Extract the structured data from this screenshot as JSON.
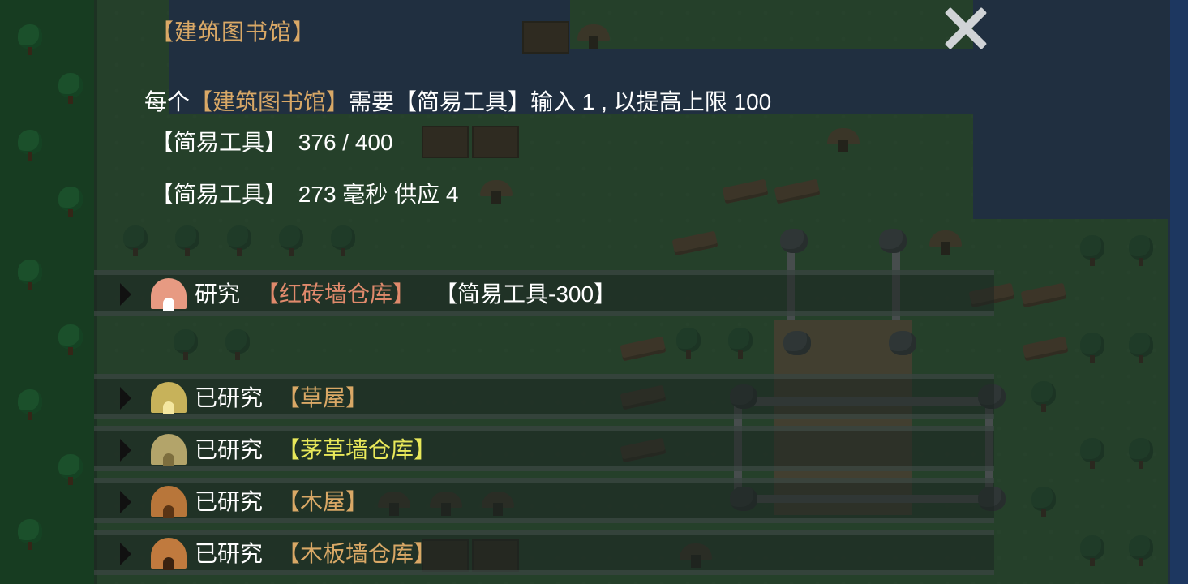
{
  "panel": {
    "title": "【建筑图书馆】",
    "close_label": "close"
  },
  "info": {
    "l1_prefix": "每个",
    "l1_building": "【建筑图书馆】",
    "l1_mid": "需要【简易工具】输入 1 , 以提高上限 100",
    "l2_item": "【简易工具】",
    "l2_value": "376 / 400",
    "l3_item": "【简易工具】",
    "l3_value": "273 毫秒 供应 4"
  },
  "research": [
    {
      "status": "研究",
      "name": "【红砖墙仓库】",
      "cost": "【简易工具-300】",
      "name_color": "#e08a6c",
      "icon": "brick-hut-icon",
      "roof": "#e79a82",
      "door": "#ffffff"
    },
    {
      "status": "已研究",
      "name": "【草屋】",
      "cost": "",
      "name_color": "#d9a866",
      "icon": "straw-hut-icon",
      "roof": "#c7b25a",
      "door": "#f4e7a0"
    },
    {
      "status": "已研究",
      "name": "【茅草墙仓库】",
      "cost": "",
      "name_color": "#e8e85a",
      "icon": "thatch-hut-icon",
      "roof": "#b3a46a",
      "door": "#7d6e3e"
    },
    {
      "status": "已研究",
      "name": "【木屋】",
      "cost": "",
      "name_color": "#d9a866",
      "icon": "wood-hut-icon",
      "roof": "#b8763a",
      "door": "#5a3414"
    },
    {
      "status": "已研究",
      "name": "【木板墙仓库】",
      "cost": "",
      "name_color": "#d9a866",
      "icon": "plank-hut-icon",
      "roof": "#c07a3e",
      "door": "#3a2210"
    }
  ]
}
